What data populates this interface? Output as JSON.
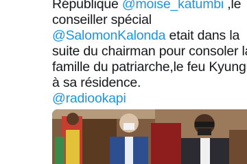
{
  "tweet": {
    "line1_prefix": "République ",
    "mention1": "@moise_katumbi",
    "line1_suffix": " ,le",
    "line2": "conseiller spécial",
    "mention2": "@SalomonKalonda",
    "line3_suffix": " etait dans la",
    "line4": "suite du chairman pour  consoler la",
    "line5": "famille du patriarche,le feu Kyungu",
    "line6": "à sa résidence.",
    "handle": "@radiookapi"
  },
  "photo": {
    "alt": "attached-photo"
  }
}
